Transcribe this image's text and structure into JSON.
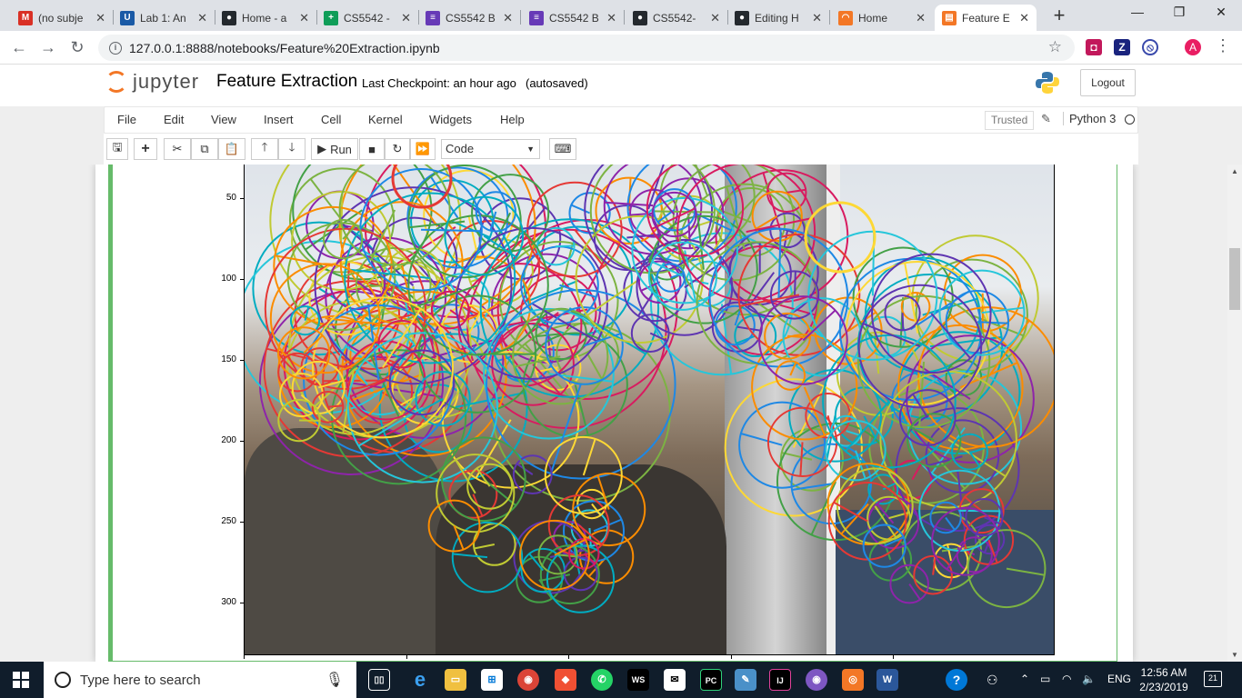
{
  "browser": {
    "tabs": [
      {
        "title": "(no subje",
        "icon": "gmail-icon",
        "color": "#d93025",
        "glyph": "M"
      },
      {
        "title": "Lab 1: An",
        "icon": "umkc-icon",
        "color": "#1a5aa6",
        "glyph": "U"
      },
      {
        "title": "Home - a",
        "icon": "github-icon",
        "color": "#24292e",
        "glyph": "●"
      },
      {
        "title": "CS5542 -",
        "icon": "sheets-icon",
        "color": "#0f9d58",
        "glyph": "+"
      },
      {
        "title": "CS5542 B",
        "icon": "forms-icon",
        "color": "#673ab7",
        "glyph": "≡"
      },
      {
        "title": "CS5542 B",
        "icon": "forms-icon",
        "color": "#673ab7",
        "glyph": "≡"
      },
      {
        "title": "CS5542-",
        "icon": "github-icon",
        "color": "#24292e",
        "glyph": "●"
      },
      {
        "title": "Editing H",
        "icon": "github-icon",
        "color": "#24292e",
        "glyph": "●"
      },
      {
        "title": "Home",
        "icon": "jupyter-icon",
        "color": "#f37726",
        "glyph": "◠"
      },
      {
        "title": "Feature E",
        "icon": "notebook-icon",
        "color": "#f37726",
        "glyph": "▤"
      }
    ],
    "url": "127.0.0.1:8888/notebooks/Feature%20Extraction.ipynb",
    "profile_initial": "A"
  },
  "jupyter": {
    "logo_text": "jupyter",
    "notebook_title": "Feature Extraction",
    "checkpoint": "Last Checkpoint: an hour ago",
    "autosave": "(autosaved)",
    "logout_label": "Logout",
    "menu": [
      "File",
      "Edit",
      "View",
      "Insert",
      "Cell",
      "Kernel",
      "Widgets",
      "Help"
    ],
    "trusted_label": "Trusted",
    "kernel_name": "Python 3",
    "run_label": "Run",
    "cell_type": "Code"
  },
  "plot": {
    "y_ticks": [
      "50",
      "100",
      "150",
      "200",
      "250",
      "300"
    ],
    "ring_colors": [
      "#e53935",
      "#43a047",
      "#1e88e5",
      "#8e24aa",
      "#fdd835",
      "#00acc1",
      "#fb8c00",
      "#d81b60",
      "#7cb342",
      "#5e35b1",
      "#26c6da",
      "#c0ca33"
    ]
  },
  "taskbar": {
    "search_placeholder": "Type here to search",
    "language": "ENG",
    "time": "12:56 AM",
    "date": "2/23/2019",
    "notification_count": "21"
  }
}
